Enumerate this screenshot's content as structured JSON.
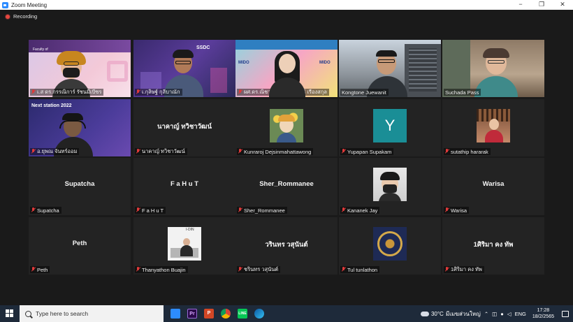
{
  "window": {
    "title": "Zoom Meeting",
    "minimize": "−",
    "maximize": "❐",
    "close": "✕"
  },
  "recording": {
    "label": "Recording"
  },
  "colors": {
    "active_speaker": "#e8e64a",
    "muted": "#e03a3a",
    "tile_bg": "#232323"
  },
  "participants": [
    {
      "name": "เ.ส ดร.กรรณิการ์ รัชนมีเบีซร",
      "display": "",
      "kind": "video",
      "active": true,
      "muted": true
    },
    {
      "name": "เ.กุลิษฐ์ กุลีบาณัก",
      "display": "",
      "kind": "video",
      "muted": true
    },
    {
      "name": "ผศ.ดร.ณิชาตา ดร.อนรรัตน์ เรืองสกุล",
      "display": "",
      "kind": "video",
      "muted": true
    },
    {
      "name": "Kongtone Juewanit",
      "display": "",
      "kind": "video",
      "muted": false
    },
    {
      "name": "Suchada Pass",
      "display": "",
      "kind": "video",
      "muted": false
    },
    {
      "name": "อ.ยุพณ จันทร์ออม",
      "display": "",
      "kind": "video",
      "muted": true
    },
    {
      "name": "นาคาญ์ ทวิชาวัฒน์",
      "display": "นาคาญ์ ทวิชาวัฒน์",
      "kind": "name",
      "muted": true
    },
    {
      "name": "Kunraroj Dejsinmahattawong",
      "display": "",
      "kind": "photo",
      "muted": true
    },
    {
      "name": "Yupapan Supakam",
      "display": "",
      "kind": "letter",
      "letter": "Y",
      "muted": true
    },
    {
      "name": "sutathip hararak",
      "display": "",
      "kind": "photo",
      "muted": true
    },
    {
      "name": "Supatcha",
      "display": "Supatcha",
      "kind": "name",
      "muted": true
    },
    {
      "name": "F a H u T",
      "display": "F a H u T",
      "kind": "name",
      "muted": true
    },
    {
      "name": "Sher_Rommanee",
      "display": "Sher_Rommanee",
      "kind": "name",
      "muted": true
    },
    {
      "name": "Kananek Jay",
      "display": "",
      "kind": "photo",
      "muted": true
    },
    {
      "name": "Warisa",
      "display": "Warisa",
      "kind": "name",
      "muted": true
    },
    {
      "name": "Peth",
      "display": "Peth",
      "kind": "name",
      "muted": true
    },
    {
      "name": "Thanyathon Buajin",
      "display": "",
      "kind": "photo",
      "muted": true
    },
    {
      "name": "ชรินทร วสุนันต์",
      "display": "วรินทร วสุนันต์",
      "kind": "name",
      "muted": true
    },
    {
      "name": "Tul tunlathon",
      "display": "",
      "kind": "photo",
      "muted": true
    },
    {
      "name": "1ศิริมา คง ทัพ",
      "display": "1ศิริมา คง ทัพ",
      "kind": "name",
      "muted": true
    }
  ],
  "slide_texts": {
    "banner_1": "Faculty of",
    "next_station": "Next station 2022",
    "mido": "MIDO",
    "ssdc": "SSDC",
    "idin": "I-DIN"
  },
  "taskbar": {
    "search_placeholder": "Type here to search",
    "apps": [
      "zoom",
      "Pr",
      "P",
      "chrome",
      "LINE",
      "edge"
    ],
    "temperature": "30°C",
    "weather_text": "มีเมฆส่วนใหญ่",
    "language": "ENG",
    "time": "17:28",
    "date": "18/2/2565"
  }
}
